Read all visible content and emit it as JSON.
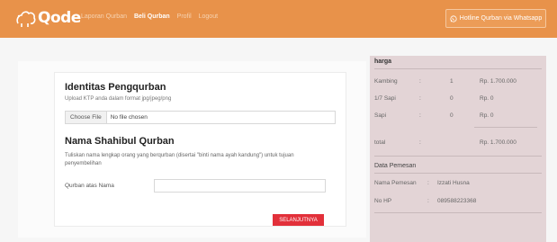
{
  "navbar": {
    "logo_text": "Qode",
    "links": [
      "Laporan Qurban",
      "Beli Qurban",
      "Profil",
      "Logout"
    ],
    "active_index": 1,
    "hotline": "Hotline Qurban via Whatsapp"
  },
  "form": {
    "identity_title": "Identitas Pengqurban",
    "identity_sub": "Upload KTP anda dalam format jpg/jpeg/png",
    "file_button": "Choose File",
    "file_status": "No file chosen",
    "name_title": "Nama Shahibul Qurban",
    "name_desc": "Tuliskan nama lengkap orang yang berqurban (disertai \"binti nama ayah kandung\") untuk tujuan penyembelihan",
    "field_label": "Qurban atas Nama",
    "field_value": "",
    "next_button": "SELANJUTNYA"
  },
  "summary": {
    "price_title": "harga",
    "items": [
      {
        "name": "Kambing",
        "colon": ":",
        "qty": "1",
        "price": "Rp. 1.700.000"
      },
      {
        "name": "1/7 Sapi",
        "colon": ":",
        "qty": "0",
        "price": "Rp. 0"
      },
      {
        "name": "Sapi",
        "colon": ":",
        "qty": "0",
        "price": "Rp. 0"
      }
    ],
    "total_label": "total",
    "total_colon": ":",
    "total_value": "Rp. 1.700.000",
    "buyer_title": "Data Pemesan",
    "buyer": [
      {
        "label": "Nama Pemesan",
        "colon": ":",
        "value": "Izzati Husna"
      },
      {
        "label": "No HP",
        "colon": ":",
        "value": "089588223368"
      }
    ]
  },
  "colors": {
    "navbar": "#e8924a",
    "next_button": "#e2303a",
    "summary_bg": "#e3d4d6"
  }
}
